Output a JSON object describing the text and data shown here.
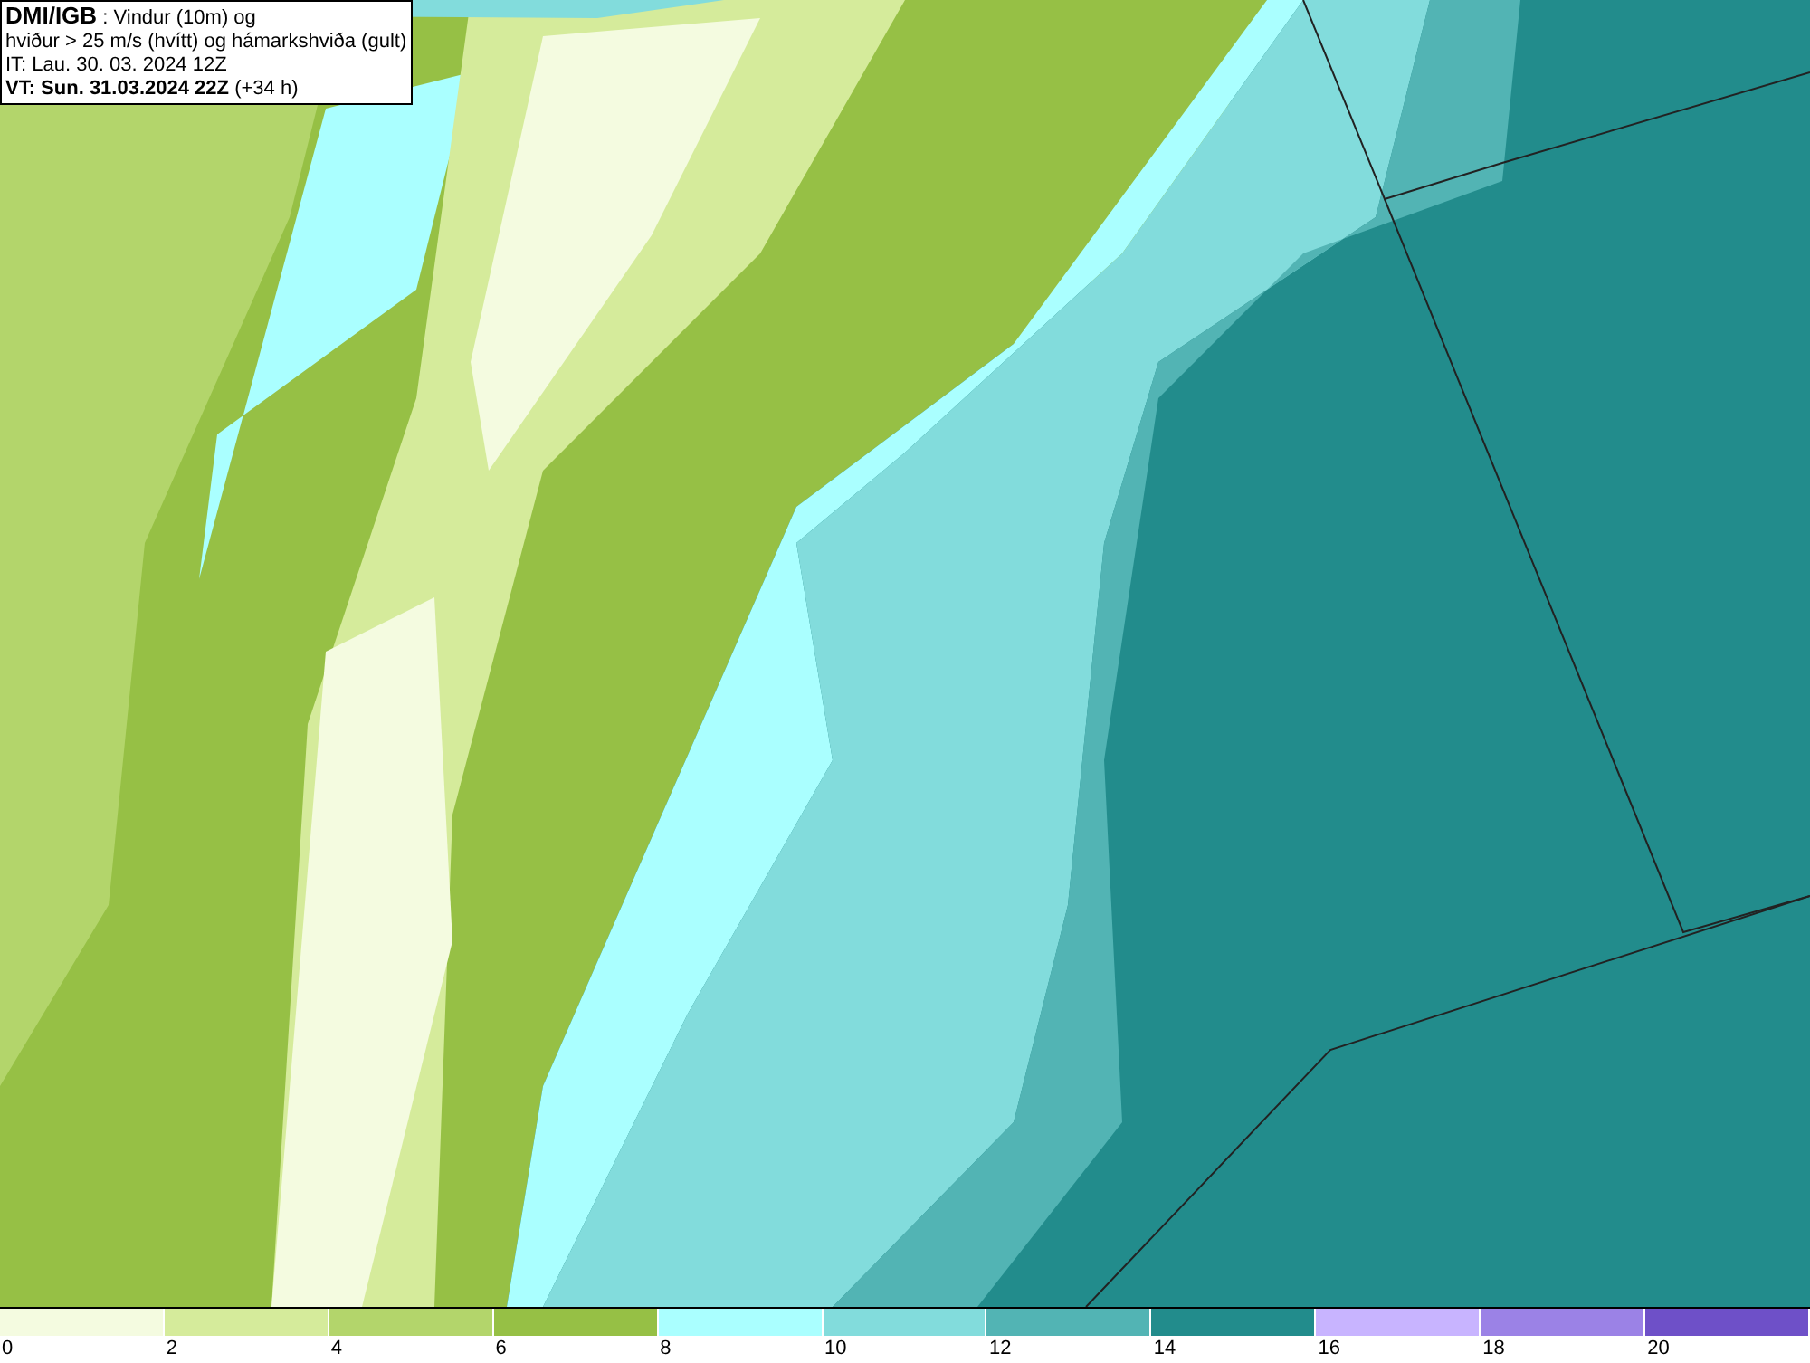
{
  "info_box": {
    "source": "DMI/IGB",
    "title_rest": ": Vindur (10m) og",
    "subtitle": "hviður > 25 m/s (hvítt) og hámarkshviða (gult)",
    "issue_time": "IT: Lau. 30. 03. 2024 12Z",
    "valid_time": "VT: Sun. 31.03.2024 22Z",
    "lead_time": "(+34 h)"
  },
  "legend": [
    {
      "label": "0",
      "color": "#f4fbe0"
    },
    {
      "label": "2",
      "color": "#d5eb9b"
    },
    {
      "label": "4",
      "color": "#b3d56b"
    },
    {
      "label": "6",
      "color": "#96c045"
    },
    {
      "label": "8",
      "color": "#aaffff"
    },
    {
      "label": "10",
      "color": "#82dcdc"
    },
    {
      "label": "12",
      "color": "#52b4b4"
    },
    {
      "label": "14",
      "color": "#228c8c"
    },
    {
      "label": "16",
      "color": "#c8b4ff"
    },
    {
      "label": "18",
      "color": "#9b82e6"
    },
    {
      "label": "20",
      "color": "#6e50c8"
    }
  ]
}
